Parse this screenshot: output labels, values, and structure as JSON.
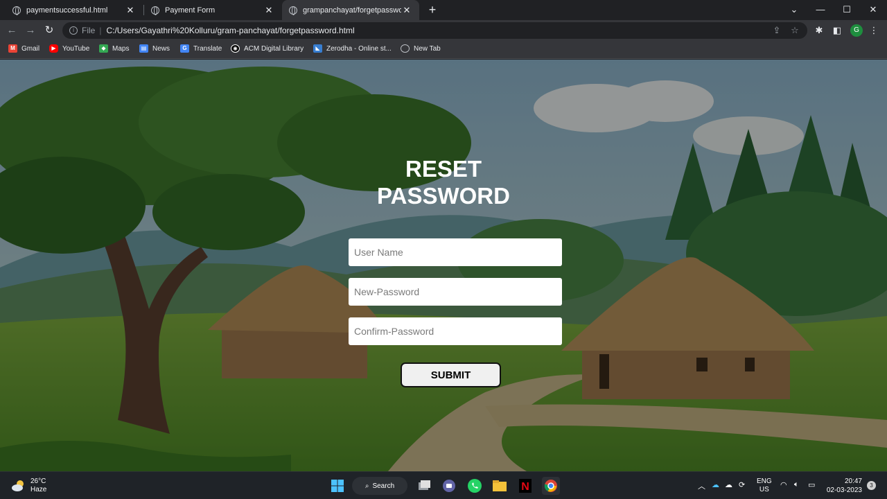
{
  "browser": {
    "tabs": [
      {
        "title": "paymentsuccessful.html",
        "active": false
      },
      {
        "title": "Payment Form",
        "active": false
      },
      {
        "title": "grampanchayat/forgetpassword",
        "active": true
      }
    ],
    "address": {
      "scheme": "File",
      "url": "C:/Users/Gayathri%20Kolluru/gram-panchayat/forgetpassword.html"
    },
    "profile_initial": "G",
    "bookmarks": [
      "Gmail",
      "YouTube",
      "Maps",
      "News",
      "Translate",
      "ACM Digital Library",
      "Zerodha - Online st...",
      "New Tab"
    ]
  },
  "page": {
    "heading_line1": "RESET",
    "heading_line2": "PASSWORD",
    "username_placeholder": "User Name",
    "new_password_placeholder": "New-Password",
    "confirm_password_placeholder": "Confirm-Password",
    "submit_label": "SUBMIT"
  },
  "taskbar": {
    "temperature": "26°C",
    "weather": "Haze",
    "search_label": "Search",
    "language": "ENG",
    "region": "US",
    "time": "20:47",
    "date": "02-03-2023",
    "notification_count": "3"
  }
}
